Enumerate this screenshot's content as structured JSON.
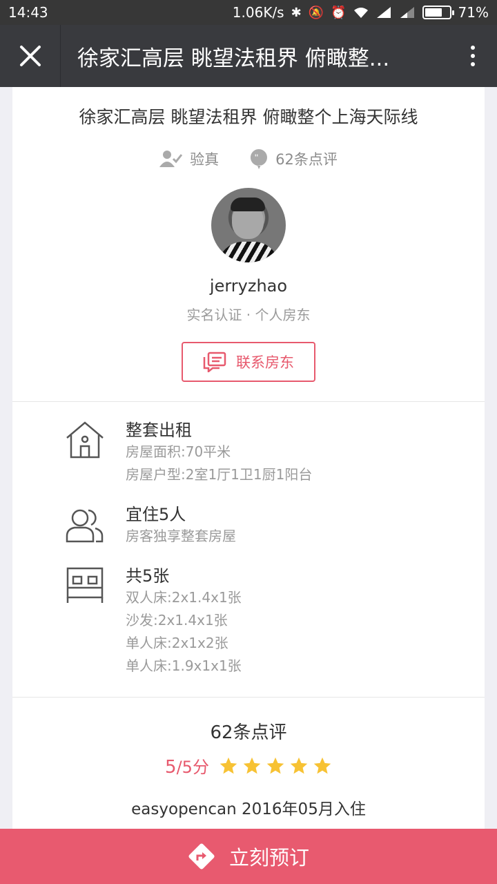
{
  "status_bar": {
    "time": "14:43",
    "net_speed": "1.06K/s",
    "battery_percent": "71%",
    "battery_level": 0.71
  },
  "nav": {
    "title": "徐家汇高层 眺望法租界 俯瞰整..."
  },
  "listing": {
    "title": "徐家汇高层 眺望法租界 俯瞰整个上海天际线",
    "verified_label": "验真",
    "reviews_label": "62条点评"
  },
  "host": {
    "name": "jerryzhao",
    "subtitle": "实名认证 · 个人房东",
    "contact_label": "联系房东"
  },
  "features": [
    {
      "icon": "house-icon",
      "heading": "整套出租",
      "lines": [
        "房屋面积:70平米",
        "房屋户型:2室1厅1卫1厨1阳台"
      ]
    },
    {
      "icon": "guests-icon",
      "heading": "宜住5人",
      "lines": [
        "房客独享整套房屋"
      ]
    },
    {
      "icon": "bed-icon",
      "heading": "共5张",
      "lines": [
        "双人床:2x1.4x1张",
        "沙发:2x1.4x1张",
        "单人床:2x1x2张",
        "单人床:1.9x1x1张"
      ]
    }
  ],
  "reviews": {
    "title": "62条点评",
    "score": "5",
    "score_suffix": "/5分",
    "stars": 5,
    "first_review_meta": "easyopencan 2016年05月入住"
  },
  "book": {
    "label": "立刻预订"
  },
  "colors": {
    "accent": "#e7596d",
    "nav_bg": "#393a3e",
    "star": "#f7c234"
  }
}
